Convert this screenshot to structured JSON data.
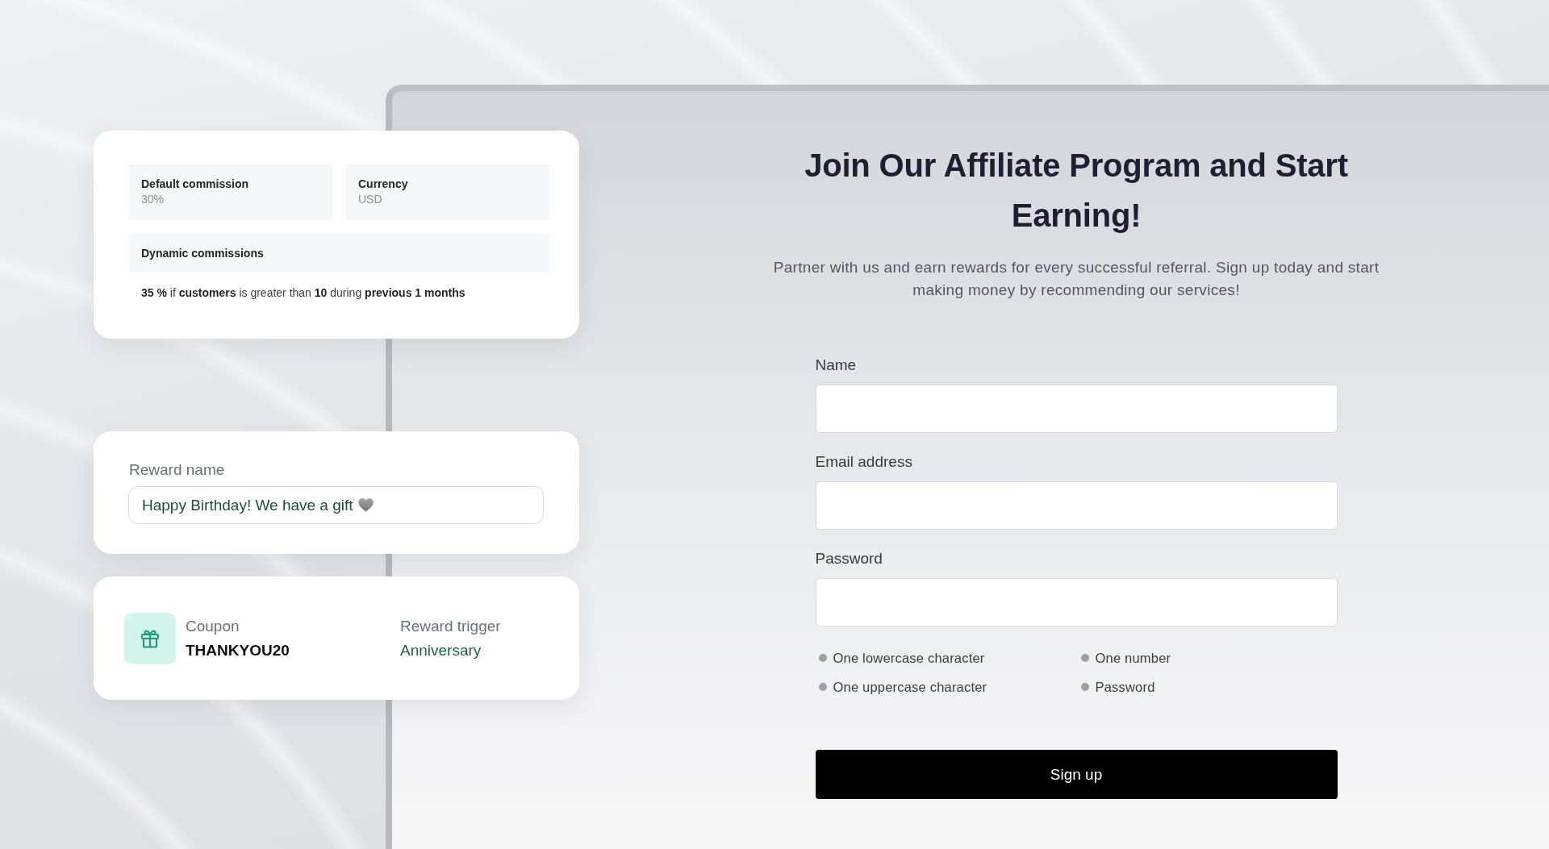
{
  "commission_card": {
    "fields": [
      {
        "label": "Default commission",
        "value": "30%"
      },
      {
        "label": "Currency",
        "value": "USD"
      }
    ],
    "dynamic_commissions": {
      "heading": "Dynamic commissions",
      "rule": "**35 %** if **customers** is greater than **10** during **previous 1 months**"
    }
  },
  "reward_name_card": {
    "label": "Reward name",
    "value": "Happy Birthday! We have a gift"
  },
  "coupon_card": {
    "coupon_label": "Coupon",
    "coupon_code": "THANKYOU20",
    "trigger_label": "Reward trigger",
    "trigger_value": "Anniversary"
  },
  "signup": {
    "title": "Join Our Affiliate Program and Start Earning!",
    "subtitle": "Partner with us and earn rewards for every successful referral. Sign up today and start making money by recommending our services!",
    "fields": [
      {
        "label": "Name"
      },
      {
        "label": "Email address"
      },
      {
        "label": "Password"
      }
    ],
    "password_rules": [
      {
        "text": "One lowercase character",
        "met": false
      },
      {
        "text": "One number",
        "met": false
      },
      {
        "text": "One uppercase character",
        "met": false
      },
      {
        "text": "Password",
        "met": false
      }
    ],
    "submit_button": "Sign up"
  }
}
